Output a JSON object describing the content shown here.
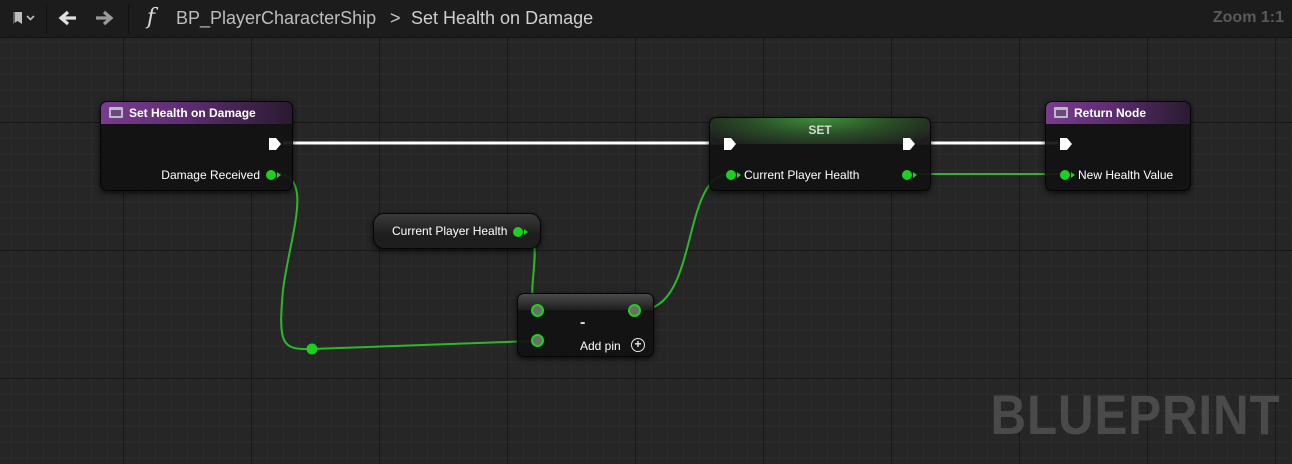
{
  "toolbar": {
    "bookmark_icon": "bookmark-icon",
    "back_icon": "arrow-left-icon",
    "forward_icon": "arrow-right-icon",
    "function_icon": "function-icon",
    "function_glyph": "f",
    "breadcrumb": [
      "BP_PlayerCharacterShip",
      "Set Health on Damage"
    ],
    "breadcrumb_separator": ">",
    "zoom": "Zoom 1:1"
  },
  "graph": {
    "watermark": "BLUEPRINT",
    "nodes": {
      "entry": {
        "title": "Set Health on Damage",
        "output_pin": "Damage Received",
        "header_color": "#7a3b8f"
      },
      "get_var": {
        "label": "Current Player Health"
      },
      "subtract": {
        "operator": "-",
        "add_pin": "Add pin",
        "add_pin_glyph": "+"
      },
      "set": {
        "title": "SET",
        "input_pin": "Current Player Health",
        "header_color": "#3f8f3a"
      },
      "return": {
        "title": "Return Node",
        "input_pin": "New Health Value",
        "header_color": "#7a3b8f"
      }
    },
    "colors": {
      "float_pin": "#1fcf1f",
      "exec_wire": "#ffffff"
    }
  }
}
